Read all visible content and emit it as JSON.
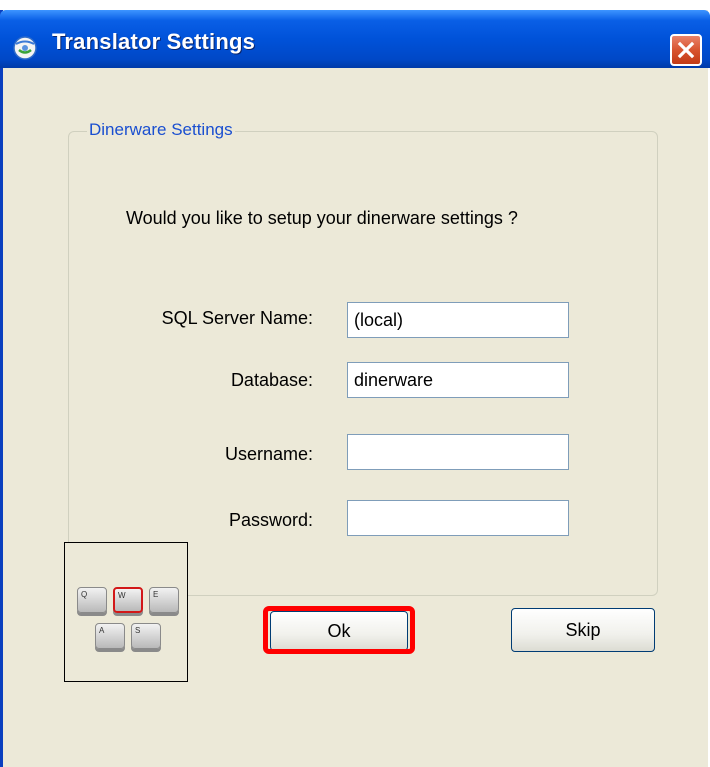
{
  "window": {
    "title": "Translator Settings",
    "close_icon": "close-icon",
    "app_icon": "globe-icon"
  },
  "group": {
    "legend": "Dinerware Settings"
  },
  "prompt": "Would you like to setup your dinerware settings ?",
  "fields": {
    "server": {
      "label": "SQL Server Name:",
      "value": "(local)"
    },
    "database": {
      "label": "Database:",
      "value": "dinerware"
    },
    "username": {
      "label": "Username:",
      "value": ""
    },
    "password": {
      "label": "Password:",
      "value": ""
    }
  },
  "keyboard": {
    "icon": "keyboard-icon",
    "keys": [
      "Q",
      "W",
      "E",
      "A",
      "S"
    ],
    "highlighted_key": "W"
  },
  "buttons": {
    "ok": "Ok",
    "skip": "Skip"
  },
  "colors": {
    "titlebar": "#0052d9",
    "dialog_bg": "#ece9d8",
    "legend_text": "#1a4fd0",
    "highlight": "#ff0000"
  }
}
